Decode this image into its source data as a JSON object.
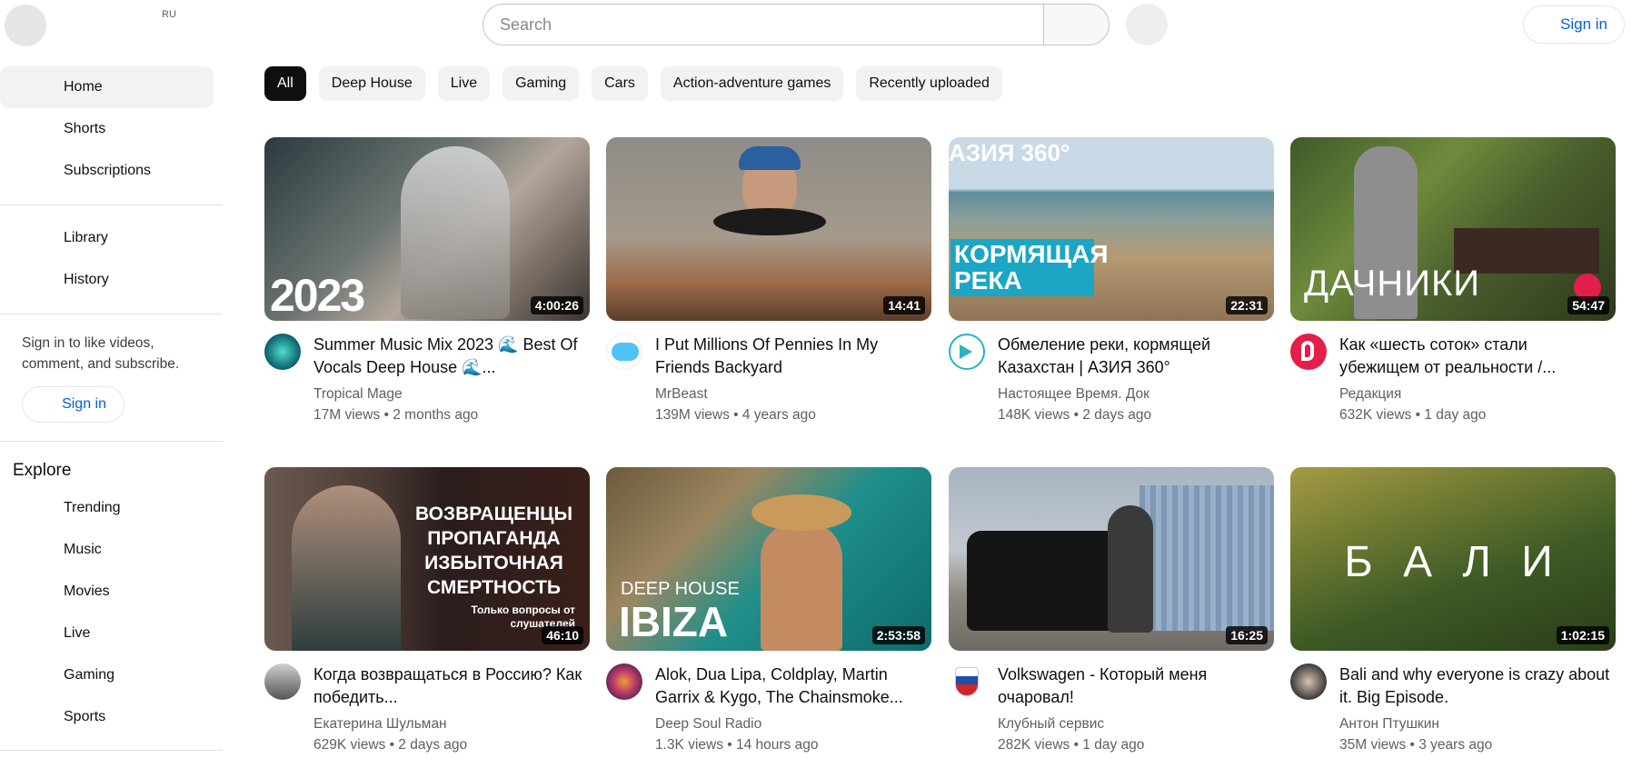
{
  "header": {
    "region": "RU",
    "search_placeholder": "Search",
    "sign_in": "Sign in"
  },
  "sidebar": {
    "primary": [
      {
        "label": "Home",
        "active": true
      },
      {
        "label": "Shorts"
      },
      {
        "label": "Subscriptions"
      }
    ],
    "secondary": [
      {
        "label": "Library"
      },
      {
        "label": "History"
      }
    ],
    "signin_note": "Sign in to like videos, comment, and subscribe.",
    "signin_button": "Sign in",
    "explore_title": "Explore",
    "explore": [
      {
        "label": "Trending"
      },
      {
        "label": "Music"
      },
      {
        "label": "Movies"
      },
      {
        "label": "Live"
      },
      {
        "label": "Gaming"
      },
      {
        "label": "Sports"
      }
    ]
  },
  "chips": [
    "All",
    "Deep House",
    "Live",
    "Gaming",
    "Cars",
    "Action-adventure games",
    "Recently uploaded"
  ],
  "videos": [
    {
      "title": "Summer Music Mix 2023 🌊 Best Of Vocals Deep House 🌊...",
      "channel": "Tropical Mage",
      "stats": "17M views • 2 months ago",
      "duration": "4:00:26",
      "thumb_text": "2023"
    },
    {
      "title": "I Put Millions Of Pennies In My Friends Backyard",
      "channel": "MrBeast",
      "stats": "139M views • 4 years ago",
      "duration": "14:41",
      "thumb_text": ""
    },
    {
      "title": "Обмеление реки, кормящей Казахстан | АЗИЯ 360°",
      "channel": "Настоящее Время. Док",
      "stats": "148K views • 2 days ago",
      "duration": "22:31",
      "thumb_text": "АЗИЯ 360°",
      "thumb_text2": "КОРМЯЩАЯ РЕКА"
    },
    {
      "title": "Как «шесть соток» стали убежищем от реальности /...",
      "channel": "Редакция",
      "stats": "632K views • 1 day ago",
      "duration": "54:47",
      "thumb_text": "ДАЧНИКИ"
    },
    {
      "title": "Когда возвращаться в Россию? Как победить...",
      "channel": "Екатерина Шульман",
      "stats": "629K views • 2 days ago",
      "duration": "46:10",
      "thumb_text": "ВОЗВРАЩЕНЦЫ ПРОПАГАНДА ИЗБЫТОЧНАЯ СМЕРТНОСТЬ",
      "thumb_text2": "Только вопросы от слушателей"
    },
    {
      "title": "Alok, Dua Lipa, Coldplay, Martin Garrix & Kygo, The Chainsmoke...",
      "channel": "Deep Soul Radio",
      "stats": "1.3K views • 14 hours ago",
      "duration": "2:53:58",
      "thumb_text": "DEEP HOUSE",
      "thumb_text2": "IBIZA"
    },
    {
      "title": "Volkswagen - Который меня очаровал!",
      "channel": "Клубный сервис",
      "stats": "282K views • 1 day ago",
      "duration": "16:25",
      "thumb_text": ""
    },
    {
      "title": "Bali and why everyone is crazy about it. Big Episode.",
      "channel": "Антон Птушкин",
      "stats": "35M views • 3 years ago",
      "duration": "1:02:15",
      "thumb_text": "Б А Л И"
    }
  ]
}
